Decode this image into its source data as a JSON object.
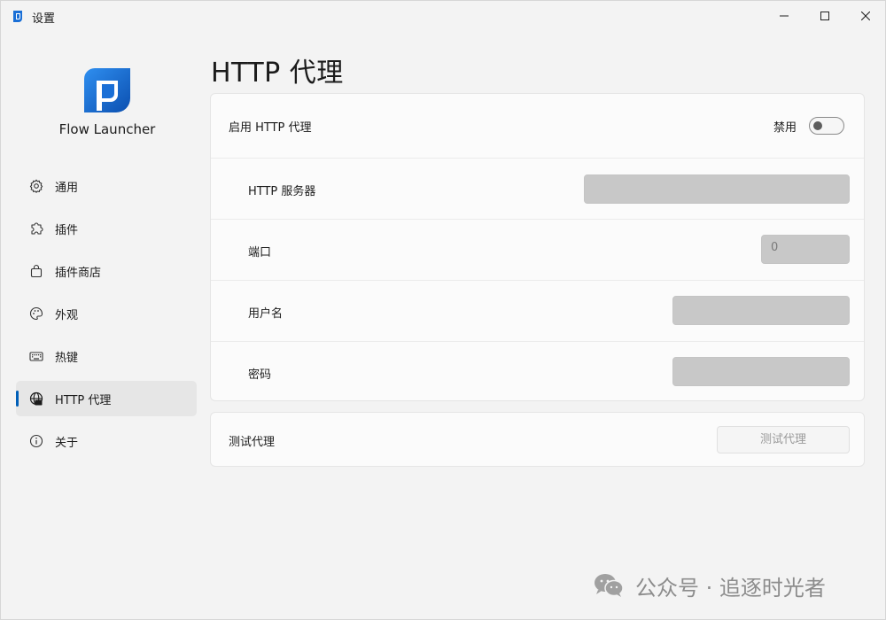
{
  "window": {
    "title": "设置"
  },
  "brand": {
    "name": "Flow Launcher"
  },
  "sidebar": {
    "items": [
      {
        "label": "通用",
        "icon": "gear-icon"
      },
      {
        "label": "插件",
        "icon": "puzzle-icon"
      },
      {
        "label": "插件商店",
        "icon": "shopping-bag-icon"
      },
      {
        "label": "外观",
        "icon": "palette-icon"
      },
      {
        "label": "热键",
        "icon": "keyboard-icon"
      },
      {
        "label": "HTTP 代理",
        "icon": "globe-icon",
        "active": true
      },
      {
        "label": "关于",
        "icon": "info-icon"
      }
    ]
  },
  "main": {
    "title": "HTTP 代理",
    "proxy": {
      "enable_label": "启用 HTTP 代理",
      "toggle_state_label": "禁用",
      "toggle_on": false,
      "server_label": "HTTP 服务器",
      "server_value": "",
      "port_label": "端口",
      "port_value": "0",
      "username_label": "用户名",
      "username_value": "",
      "password_label": "密码",
      "password_value": ""
    },
    "test": {
      "label": "测试代理",
      "button_label": "测试代理"
    }
  },
  "watermark": {
    "text": "公众号 · 追逐时光者",
    "icon": "wechat-icon"
  },
  "colors": {
    "accent": "#005fb8",
    "input_bg": "#c8c8c8",
    "window_bg": "#f3f3f3",
    "card_bg": "#fbfbfb"
  }
}
